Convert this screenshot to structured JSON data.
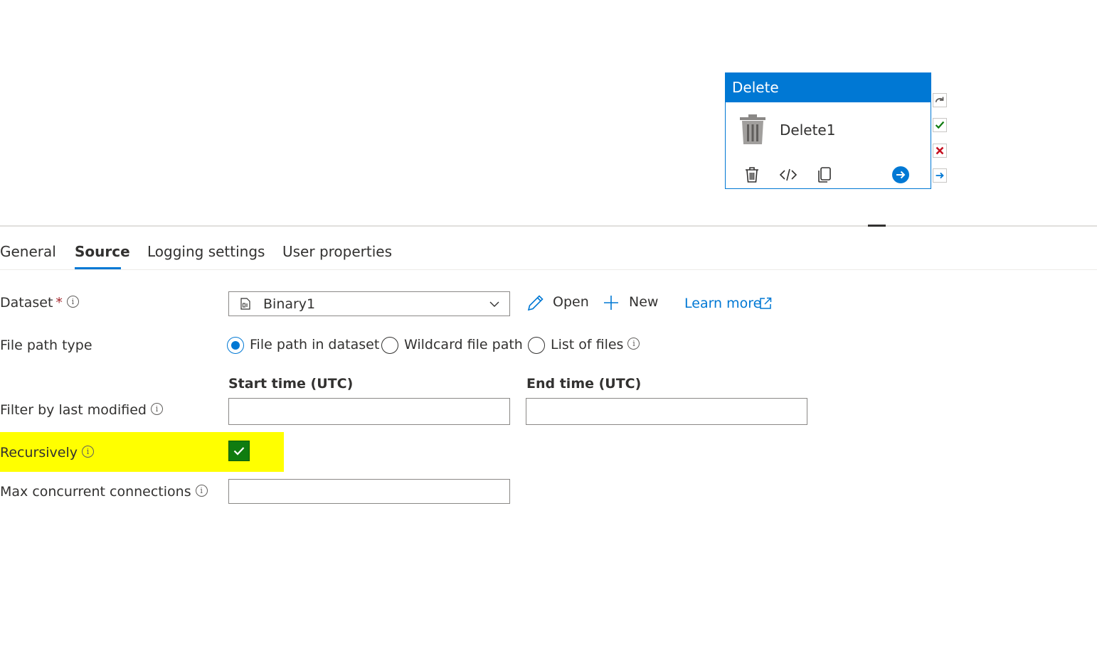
{
  "activity": {
    "header": "Delete",
    "name": "Delete1",
    "icons": [
      "trash-icon",
      "code-icon",
      "copy-icon",
      "arrow-circle-right-icon"
    ]
  },
  "side_icons": [
    "redo-icon",
    "check-icon",
    "close-icon",
    "arrow-right-icon"
  ],
  "tabs": [
    {
      "label": "General"
    },
    {
      "label": "Source",
      "active": true
    },
    {
      "label": "Logging settings"
    },
    {
      "label": "User properties"
    }
  ],
  "form": {
    "dataset": {
      "label": "Dataset",
      "required_marker": "*",
      "value": "Binary1",
      "open_label": "Open",
      "new_label": "New",
      "learn_more_label": "Learn more"
    },
    "file_path_type": {
      "label": "File path type",
      "options": [
        {
          "label": "File path in dataset",
          "selected": true
        },
        {
          "label": "Wildcard file path",
          "selected": false
        },
        {
          "label": "List of files",
          "selected": false
        }
      ]
    },
    "filter": {
      "label": "Filter by last modified",
      "start_label": "Start time (UTC)",
      "end_label": "End time (UTC)",
      "start_value": "",
      "end_value": ""
    },
    "recursively": {
      "label": "Recursively",
      "checked": true
    },
    "max_connections": {
      "label": "Max concurrent connections",
      "value": ""
    }
  },
  "colors": {
    "accent": "#0078d4",
    "highlight": "#ffff00",
    "checkbox": "#107c10",
    "error": "#c50f1f",
    "success": "#107c10"
  }
}
